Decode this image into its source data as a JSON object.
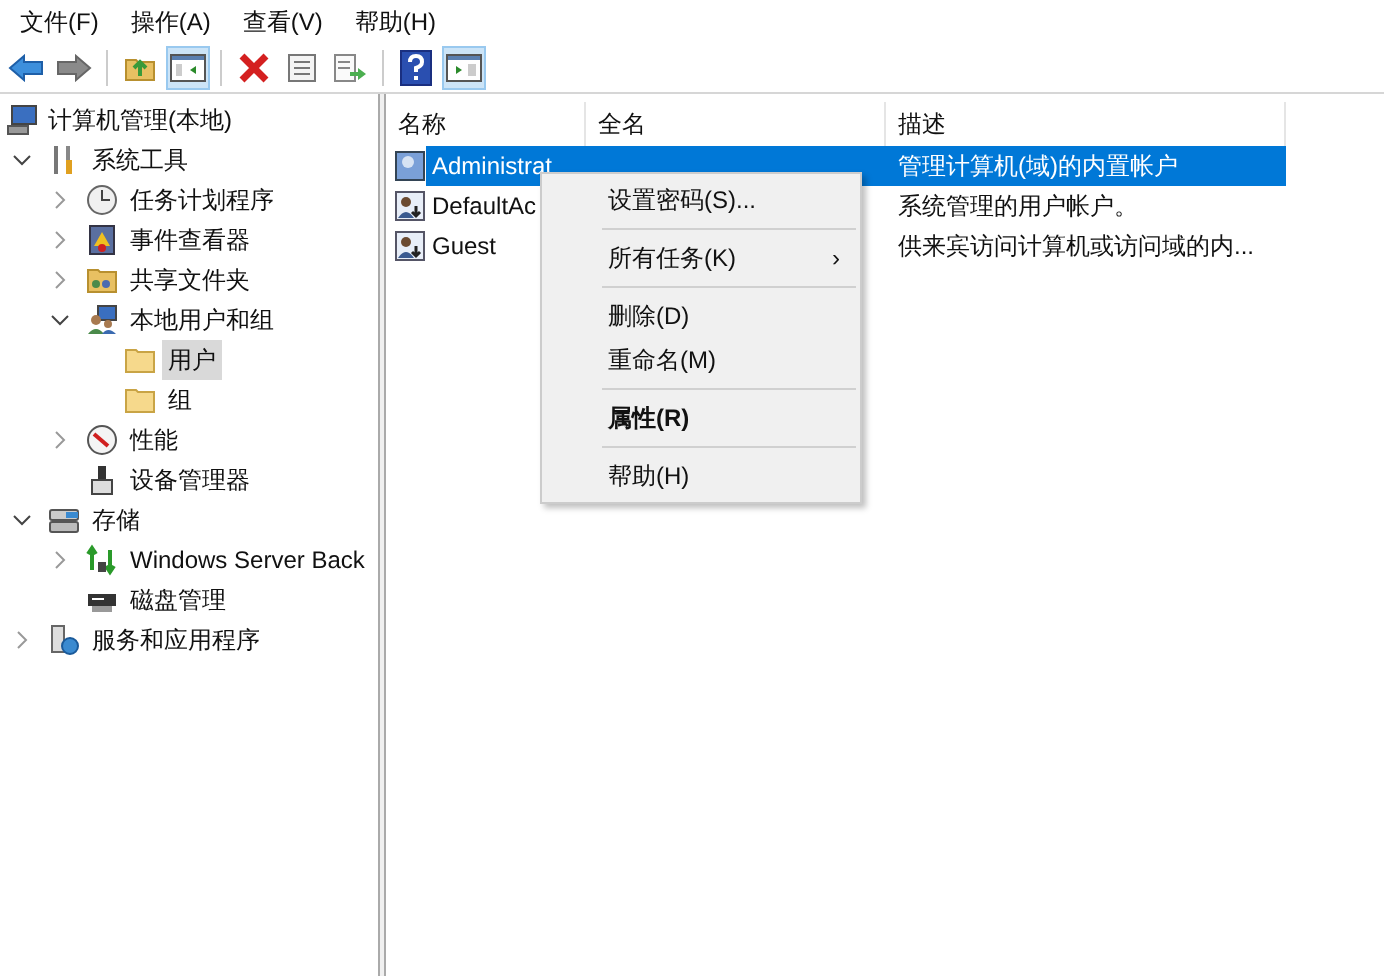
{
  "menu": [
    "文件(F)",
    "操作(A)",
    "查看(V)",
    "帮助(H)"
  ],
  "toolbar": [
    {
      "kind": "back",
      "pressed": false
    },
    {
      "kind": "forward",
      "pressed": false
    },
    {
      "kind": "sep"
    },
    {
      "kind": "up",
      "pressed": false
    },
    {
      "kind": "tree",
      "pressed": true
    },
    {
      "kind": "sep"
    },
    {
      "kind": "delete",
      "pressed": false
    },
    {
      "kind": "properties",
      "pressed": false
    },
    {
      "kind": "export",
      "pressed": false
    },
    {
      "kind": "sep"
    },
    {
      "kind": "help",
      "pressed": false
    },
    {
      "kind": "actionpane",
      "pressed": true
    }
  ],
  "tree": [
    {
      "label": "计算机管理(本地)",
      "kind": "computer",
      "selected": false,
      "children": [
        {
          "label": "系统工具",
          "kind": "tools",
          "selected": false,
          "expanded": true,
          "children": [
            {
              "label": "任务计划程序",
              "kind": "clock",
              "selected": false,
              "expanded": false
            },
            {
              "label": "事件查看器",
              "kind": "event",
              "selected": false,
              "expanded": false
            },
            {
              "label": "共享文件夹",
              "kind": "share",
              "selected": false,
              "expanded": false
            },
            {
              "label": "本地用户和组",
              "kind": "users",
              "selected": false,
              "expanded": true,
              "children": [
                {
                  "label": "用户",
                  "kind": "folder",
                  "selected": true
                },
                {
                  "label": "组",
                  "kind": "folder",
                  "selected": false
                }
              ]
            },
            {
              "label": "性能",
              "kind": "perf",
              "selected": false,
              "expanded": false
            },
            {
              "label": "设备管理器",
              "kind": "device",
              "selected": false
            }
          ]
        },
        {
          "label": "存储",
          "kind": "storage",
          "selected": false,
          "expanded": true,
          "children": [
            {
              "label": "Windows Server Back",
              "kind": "backup",
              "selected": false,
              "expanded": false
            },
            {
              "label": "磁盘管理",
              "kind": "disk",
              "selected": false
            }
          ]
        },
        {
          "label": "服务和应用程序",
          "kind": "services",
          "selected": false,
          "expanded": false
        }
      ]
    }
  ],
  "table": {
    "columns": [
      "名称",
      "全名",
      "描述"
    ],
    "rows": [
      {
        "name": "Administrat",
        "description": "管理计算机(域)的内置帐户",
        "selected": true,
        "kind": "admin"
      },
      {
        "name": "DefaultAc",
        "description": "系统管理的用户帐户。",
        "selected": false,
        "kind": "user"
      },
      {
        "name": "Guest",
        "description": "供来宾访问计算机或访问域的内...",
        "selected": false,
        "kind": "user"
      }
    ]
  },
  "context_menu": [
    {
      "kind": "item",
      "label": "设置密码(S)...",
      "bold": false
    },
    {
      "kind": "sep"
    },
    {
      "kind": "submenu",
      "label": "所有任务(K)",
      "arrow": "›",
      "bold": false
    },
    {
      "kind": "sep"
    },
    {
      "kind": "item",
      "label": "删除(D)",
      "bold": false
    },
    {
      "kind": "item",
      "label": "重命名(M)",
      "bold": false
    },
    {
      "kind": "sep"
    },
    {
      "kind": "item",
      "label": "属性(R)",
      "bold": true
    },
    {
      "kind": "sep"
    },
    {
      "kind": "item",
      "label": "帮助(H)",
      "bold": false
    }
  ]
}
